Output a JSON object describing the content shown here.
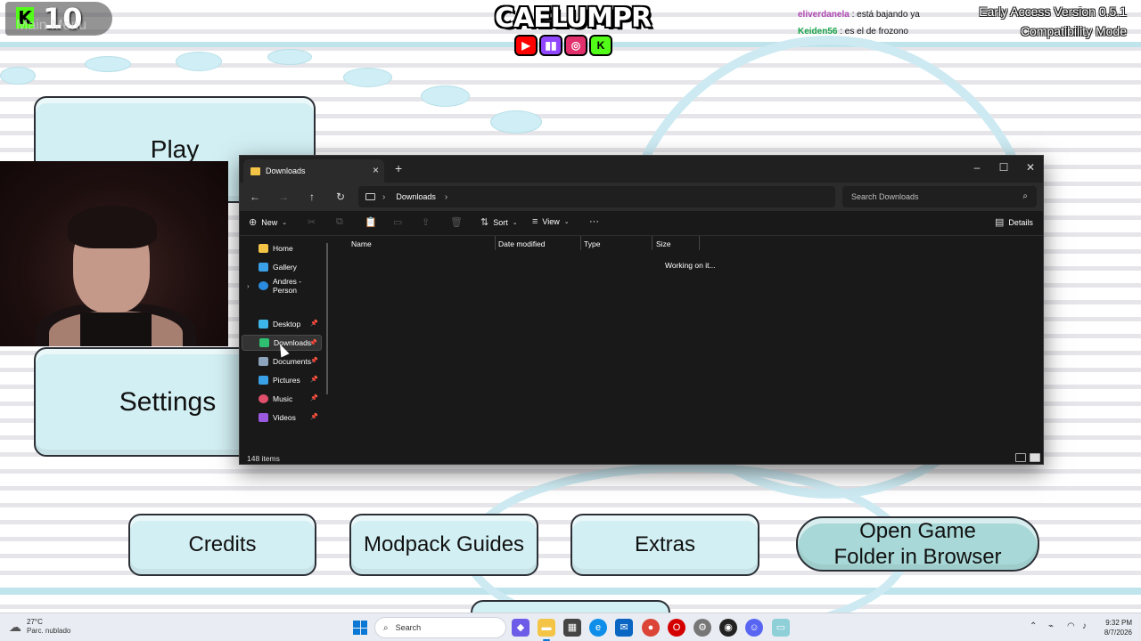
{
  "overlay": {
    "kick_number": "10",
    "screen_label": "Main Menu",
    "streamer_name": "CAELUMPR",
    "socials": [
      "youtube-icon",
      "twitch-icon",
      "instagram-icon",
      "kick-icon"
    ],
    "chat": [
      {
        "user": "eliverdanela",
        "message": ": está bajando ya",
        "color": "#b04ab3"
      },
      {
        "user": "Keiden56",
        "message": ": es el de frozono",
        "color": "#1aa54a"
      }
    ],
    "version": "Early Access Version 0.5.1",
    "mode": "Compatibility Mode"
  },
  "game_menu": {
    "play": "Play",
    "settings": "Settings",
    "credits": "Credits",
    "modpack_guides": "Modpack Guides",
    "extras": "Extras",
    "open_folder_line1": "Open Game",
    "open_folder_line2": "Folder in Browser"
  },
  "explorer": {
    "tab_title": "Downloads",
    "address_path": "Downloads",
    "search_placeholder": "Search Downloads",
    "toolbar": {
      "new": "New",
      "sort": "Sort",
      "view": "View",
      "more": "···",
      "details": "Details"
    },
    "nav": [
      {
        "label": "Home",
        "color": "#f4c446",
        "pinned": false,
        "icon": "home-icon"
      },
      {
        "label": "Gallery",
        "color": "#3aa0e8",
        "pinned": false,
        "icon": "gallery-icon"
      },
      {
        "label": "Andres - Person",
        "color": "#2a8be0",
        "pinned": false,
        "icon": "onedrive-icon"
      },
      {
        "label": "Desktop",
        "color": "#3db7e8",
        "pinned": true,
        "icon": "desktop-icon"
      },
      {
        "label": "Downloads",
        "color": "#2fbf71",
        "pinned": true,
        "icon": "downloads-icon"
      },
      {
        "label": "Documents",
        "color": "#8da4bd",
        "pinned": true,
        "icon": "documents-icon"
      },
      {
        "label": "Pictures",
        "color": "#3aa0e8",
        "pinned": true,
        "icon": "pictures-icon"
      },
      {
        "label": "Music",
        "color": "#e0506a",
        "pinned": true,
        "icon": "music-icon"
      },
      {
        "label": "Videos",
        "color": "#9b59e0",
        "pinned": true,
        "icon": "videos-icon"
      }
    ],
    "columns": [
      "Name",
      "Date modified",
      "Type",
      "Size"
    ],
    "loading_text": "Working on it...",
    "status": "148 items"
  },
  "taskbar": {
    "temperature": "27°C",
    "weather": "Parc. nublado",
    "search_placeholder": "Search",
    "time": "9:32 PM",
    "date": "8/7/2026"
  }
}
